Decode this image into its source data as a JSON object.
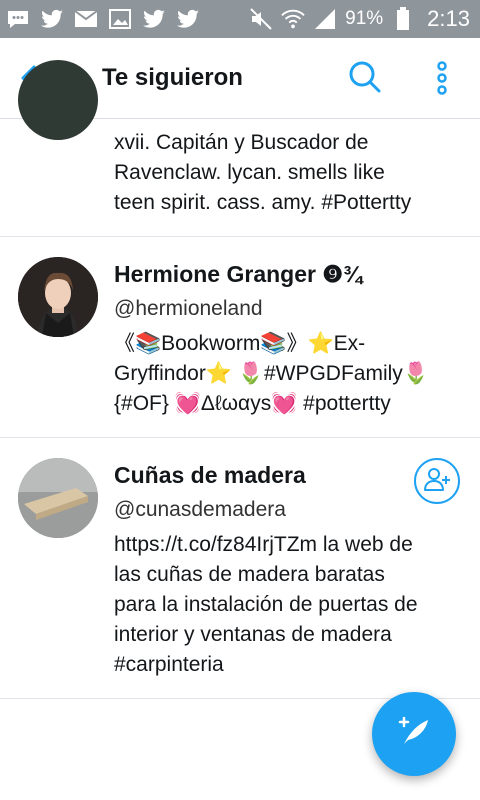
{
  "status_bar": {
    "battery_percent": "91%",
    "time": "2:13",
    "icons": [
      "chat-icon",
      "twitter-icon",
      "mail-icon",
      "image-icon",
      "twitter-icon",
      "twitter-icon",
      "mute-icon",
      "wifi-icon",
      "signal-icon",
      "battery-icon"
    ]
  },
  "header": {
    "title": "Te siguieron",
    "icons": [
      "back-arrow-icon",
      "search-icon",
      "more-vertical-icon"
    ],
    "accent_color": "#1da1f2"
  },
  "users": [
    {
      "name": "",
      "handle": "",
      "bio_lines": [
        "xvii. Capitán y Buscador de",
        "Ravenclaw. lycan. smells like",
        "teen spirit. cass. amy.  #Pottertty"
      ]
    },
    {
      "name": "Hermione Granger ❾¾",
      "handle": "@hermioneland",
      "bio_lines": [
        "《📚Bookworm📚》⭐Ex-",
        "Gryffindor⭐ 🌷#WPGDFamily🌷",
        "{#OF}   💓Δℓωαys💓 #pottertty"
      ]
    },
    {
      "name": "Cuñas de madera",
      "handle": "@cunasdemadera",
      "bio_lines": [
        "https://t.co/fz84IrjTZm la web de",
        "las cuñas de madera baratas",
        "para la instalación de puertas de",
        "interior y ventanas de madera",
        "#carpinteria"
      ],
      "follow_icon": "add-user-icon"
    }
  ],
  "fab": {
    "icon": "compose-tweet-icon"
  }
}
